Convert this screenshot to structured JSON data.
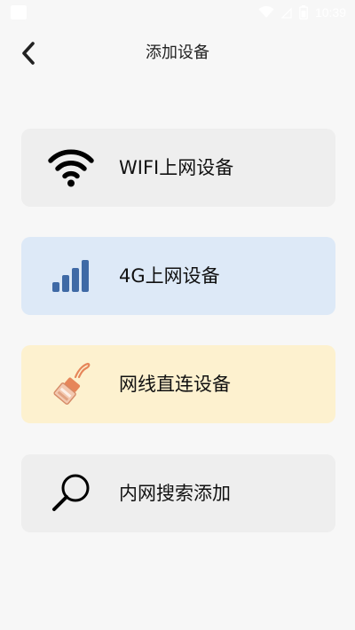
{
  "status_bar": {
    "time": "10:39",
    "icons": [
      "notification-square-icon",
      "wifi-signal-icon",
      "no-signal-icon",
      "battery-icon"
    ]
  },
  "header": {
    "title": "添加设备",
    "back_icon": "chevron-left-icon"
  },
  "options": [
    {
      "label": "WIFI上网设备",
      "icon": "wifi-icon",
      "background": "#eeeeee"
    },
    {
      "label": "4G上网设备",
      "icon": "signal-bars-icon",
      "background": "#dde9f7"
    },
    {
      "label": "网线直连设备",
      "icon": "ethernet-cable-icon",
      "background": "#fdf1cf"
    },
    {
      "label": "内网搜索添加",
      "icon": "search-icon",
      "background": "#eeeeee"
    }
  ],
  "colors": {
    "page_background": "#f7f7f7",
    "signal_bars": "#3f6aa6",
    "cable_orange": "#e6865a",
    "text": "#111111"
  }
}
